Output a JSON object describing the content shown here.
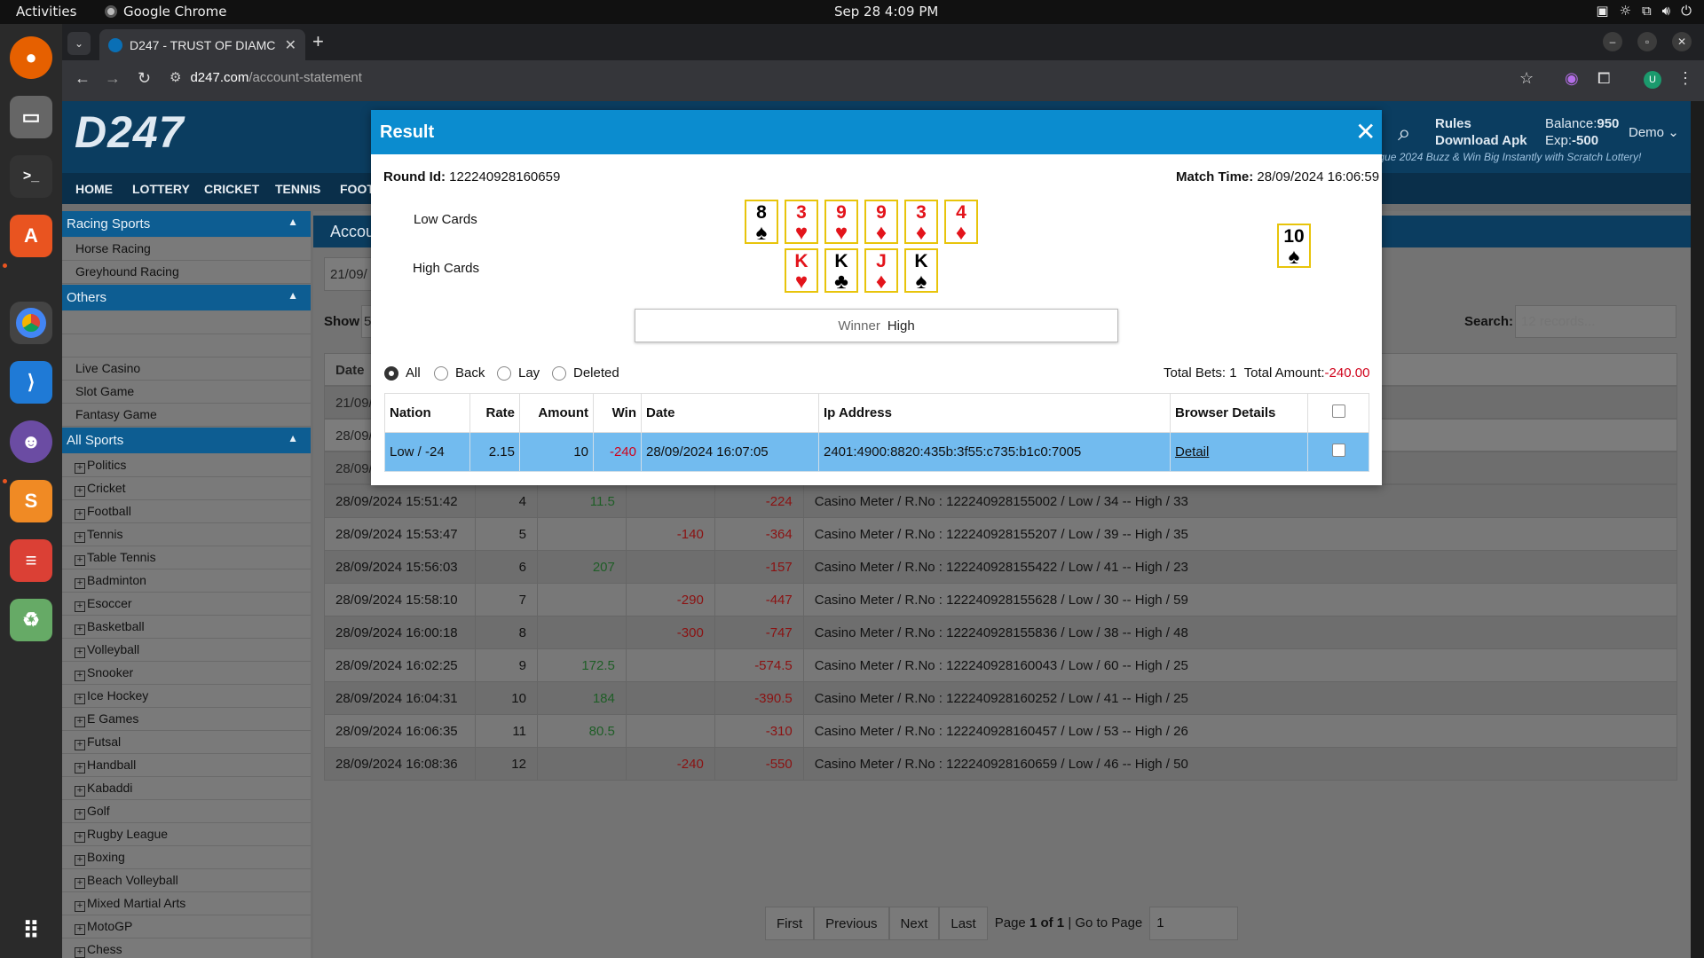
{
  "os": {
    "activities": "Activities",
    "app_name": "Google Chrome",
    "clock": "Sep 28  4:09 PM"
  },
  "browser": {
    "tab_title": "D247 - TRUST OF DIAMC",
    "url_host": "d247.com",
    "url_path": "/account-statement"
  },
  "site": {
    "logo": "D247",
    "nav": [
      "HOME",
      "LOTTERY",
      "CRICKET",
      "TENNIS",
      "FOOTE"
    ],
    "rules": "Rules",
    "download": "Download Apk",
    "balance_label": "Balance:",
    "balance_value": "950",
    "exp_label": "Exp:",
    "exp_value": "-500",
    "user": "Demo",
    "marquee": "eague 2024 Buzz & Win Big Instantly with Scratch Lottery!"
  },
  "sidebar": {
    "racing_header": "Racing Sports",
    "racing": [
      "Horse Racing",
      "Greyhound Racing"
    ],
    "others_header": "Others",
    "others": [
      "Live Casino",
      "Slot Game",
      "Fantasy Game"
    ],
    "all_sports_header": "All Sports",
    "sports": [
      "Politics",
      "Cricket",
      "Football",
      "Tennis",
      "Table Tennis",
      "Badminton",
      "Esoccer",
      "Basketball",
      "Volleyball",
      "Snooker",
      "Ice Hockey",
      "E Games",
      "Futsal",
      "Handball",
      "Kabaddi",
      "Golf",
      "Rugby League",
      "Boxing",
      "Beach Volleyball",
      "Mixed Martial Arts",
      "MotoGP",
      "Chess"
    ]
  },
  "statement": {
    "header": "Accou",
    "date_input": "21/09/",
    "show_label": "Show",
    "show_value": "5",
    "search_label": "Search:",
    "search_placeholder": "12 records...",
    "first_col_header": "Date",
    "partial_rows": [
      "21/09/",
      "28/09/",
      "28/09/"
    ],
    "rows": [
      [
        "28/09/2024 15:51:42",
        "4",
        "11.5",
        "",
        "-224",
        "Casino Meter / R.No : 122240928155002 / Low / 34 -- High / 33"
      ],
      [
        "28/09/2024 15:53:47",
        "5",
        "",
        "-140",
        "-364",
        "Casino Meter / R.No : 122240928155207 / Low / 39 -- High / 35"
      ],
      [
        "28/09/2024 15:56:03",
        "6",
        "207",
        "",
        "-157",
        "Casino Meter / R.No : 122240928155422 / Low / 41 -- High / 23"
      ],
      [
        "28/09/2024 15:58:10",
        "7",
        "",
        "-290",
        "-447",
        "Casino Meter / R.No : 122240928155628 / Low / 30 -- High / 59"
      ],
      [
        "28/09/2024 16:00:18",
        "8",
        "",
        "-300",
        "-747",
        "Casino Meter / R.No : 122240928155836 / Low / 38 -- High / 48"
      ],
      [
        "28/09/2024 16:02:25",
        "9",
        "172.5",
        "",
        "-574.5",
        "Casino Meter / R.No : 122240928160043 / Low / 60 -- High / 25"
      ],
      [
        "28/09/2024 16:04:31",
        "10",
        "184",
        "",
        "-390.5",
        "Casino Meter / R.No : 122240928160252 / Low / 41 -- High / 25"
      ],
      [
        "28/09/2024 16:06:35",
        "11",
        "80.5",
        "",
        "-310",
        "Casino Meter / R.No : 122240928160457 / Low / 53 -- High / 26"
      ],
      [
        "28/09/2024 16:08:36",
        "12",
        "",
        "-240",
        "-550",
        "Casino Meter / R.No : 122240928160659 / Low / 46 -- High / 50"
      ]
    ],
    "pager": {
      "first": "First",
      "previous": "Previous",
      "next": "Next",
      "last": "Last",
      "page_prefix": "Page",
      "page_current": "1 of 1",
      "goto": "| Go to Page",
      "goto_value": "1"
    }
  },
  "modal": {
    "title": "Result",
    "round_label": "Round Id:",
    "round_value": "122240928160659",
    "match_label": "Match Time:",
    "match_value": "28/09/2024 16:06:59",
    "low_label": "Low Cards",
    "high_label": "High Cards",
    "low_cards": [
      {
        "rank": "8",
        "suit": "♠",
        "color": "black"
      },
      {
        "rank": "3",
        "suit": "♥",
        "color": "red"
      },
      {
        "rank": "9",
        "suit": "♥",
        "color": "red"
      },
      {
        "rank": "9",
        "suit": "♦",
        "color": "red"
      },
      {
        "rank": "3",
        "suit": "♦",
        "color": "red"
      },
      {
        "rank": "4",
        "suit": "♦",
        "color": "red"
      }
    ],
    "high_cards": [
      {
        "rank": "K",
        "suit": "♥",
        "color": "red"
      },
      {
        "rank": "K",
        "suit": "♣",
        "color": "black"
      },
      {
        "rank": "J",
        "suit": "♦",
        "color": "red"
      },
      {
        "rank": "K",
        "suit": "♠",
        "color": "black"
      }
    ],
    "joker_card": {
      "rank": "10",
      "suit": "♠",
      "color": "black"
    },
    "winner_label": "Winner",
    "winner_value": "High",
    "filters": [
      "All",
      "Back",
      "Lay",
      "Deleted"
    ],
    "filter_selected": "All",
    "total_bets_label": "Total Bets:",
    "total_bets_value": "1",
    "total_amount_label": "Total Amount:",
    "total_amount_value": "-240.00",
    "columns": [
      "Nation",
      "Rate",
      "Amount",
      "Win",
      "Date",
      "Ip Address",
      "Browser Details"
    ],
    "bet": {
      "nation": "Low / -24",
      "rate": "2.15",
      "amount": "10",
      "win": "-240",
      "date": "28/09/2024 16:07:05",
      "ip": "2401:4900:8820:435b:3f55:c735:b1c0:7005",
      "detail": "Detail"
    }
  }
}
